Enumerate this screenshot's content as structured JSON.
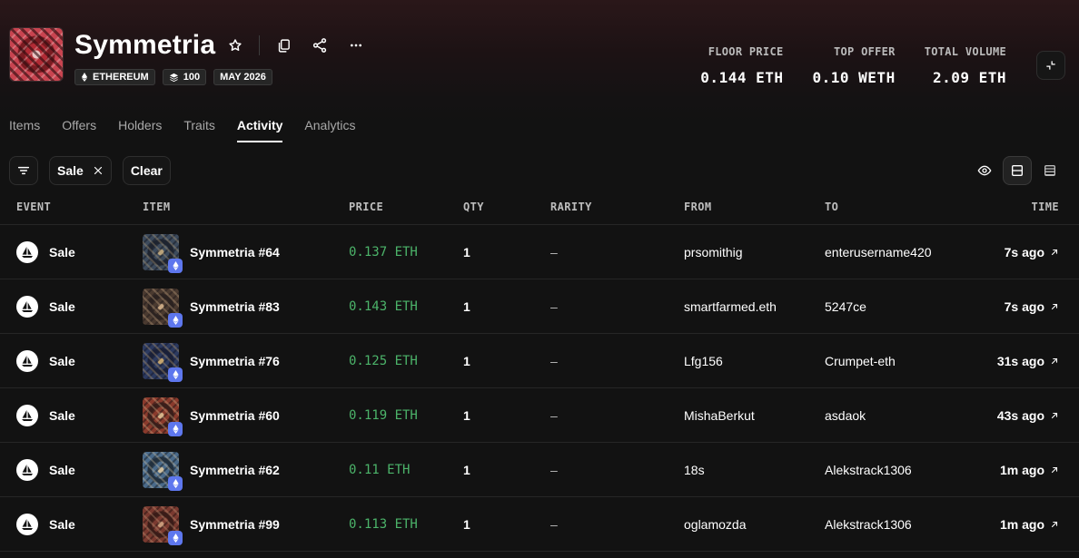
{
  "collection": {
    "name": "Symmetria",
    "badges": [
      {
        "icon": "ethereum-icon",
        "label": "ETHEREUM"
      },
      {
        "icon": "layers-icon",
        "label": "100"
      },
      {
        "icon": "",
        "label": "MAY 2026"
      }
    ]
  },
  "stats": [
    {
      "label": "FLOOR PRICE",
      "value": "0.144 ETH"
    },
    {
      "label": "TOP OFFER",
      "value": "0.10 WETH"
    },
    {
      "label": "TOTAL VOLUME",
      "value": "2.09 ETH"
    }
  ],
  "tabs": [
    {
      "label": "Items",
      "active": false
    },
    {
      "label": "Offers",
      "active": false
    },
    {
      "label": "Holders",
      "active": false
    },
    {
      "label": "Traits",
      "active": false
    },
    {
      "label": "Activity",
      "active": true
    },
    {
      "label": "Analytics",
      "active": false
    }
  ],
  "filters": {
    "chip_label": "Sale",
    "clear_label": "Clear"
  },
  "table": {
    "headers": {
      "event": "EVENT",
      "item": "ITEM",
      "price": "PRICE",
      "qty": "QTY",
      "rarity": "RARITY",
      "from": "FROM",
      "to": "TO",
      "time": "TIME"
    },
    "rows": [
      {
        "event": "Sale",
        "item": "Symmetria #64",
        "price": "0.137 ETH",
        "qty": "1",
        "rarity": "–",
        "from": "prsomithig",
        "to": "enterusername420",
        "time": "7s ago",
        "thumb_colors": [
          "#3c4a5c",
          "#b9a27a",
          "#1e2430"
        ]
      },
      {
        "event": "Sale",
        "item": "Symmetria #83",
        "price": "0.143 ETH",
        "qty": "1",
        "rarity": "–",
        "from": "smartfarmed.eth",
        "to": "5247ce",
        "time": "7s ago",
        "thumb_colors": [
          "#4a3a30",
          "#c9a883",
          "#2b2220"
        ]
      },
      {
        "event": "Sale",
        "item": "Symmetria #76",
        "price": "0.125 ETH",
        "qty": "1",
        "rarity": "–",
        "from": "Lfg156",
        "to": "Crumpet-eth",
        "time": "31s ago",
        "thumb_colors": [
          "#2c3a60",
          "#c4a46e",
          "#1a2038"
        ]
      },
      {
        "event": "Sale",
        "item": "Symmetria #60",
        "price": "0.119 ETH",
        "qty": "1",
        "rarity": "–",
        "from": "MishaBerkut",
        "to": "asdaok",
        "time": "43s ago",
        "thumb_colors": [
          "#8a3a2c",
          "#d6b48a",
          "#3a1e1a"
        ]
      },
      {
        "event": "Sale",
        "item": "Symmetria #62",
        "price": "0.11 ETH",
        "qty": "1",
        "rarity": "–",
        "from": "18s",
        "to": "Alekstrack1306",
        "time": "1m ago",
        "thumb_colors": [
          "#4a6a8a",
          "#d0c0a0",
          "#22303e"
        ]
      },
      {
        "event": "Sale",
        "item": "Symmetria #99",
        "price": "0.113 ETH",
        "qty": "1",
        "rarity": "–",
        "from": "oglamozda",
        "to": "Alekstrack1306",
        "time": "1m ago",
        "thumb_colors": [
          "#7a3a30",
          "#c89a7a",
          "#3a1c18"
        ]
      }
    ]
  },
  "colors": {
    "price_green": "#4cb46a",
    "eth_chip": "#5e77ee",
    "background": "#121212"
  }
}
